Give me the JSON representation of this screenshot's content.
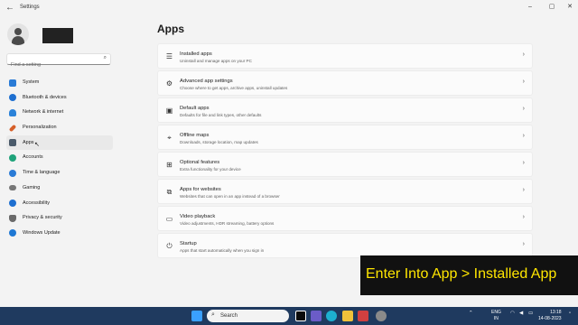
{
  "window": {
    "title": "Settings",
    "back_icon": "arrow-left-icon",
    "controls": [
      "minimize-icon",
      "maximize-icon",
      "close-icon"
    ]
  },
  "search": {
    "placeholder": "Find a setting"
  },
  "sidebar": {
    "items": [
      {
        "label": "System",
        "icon": "monitor-icon",
        "color": "#2a7bd6"
      },
      {
        "label": "Bluetooth & devices",
        "icon": "bluetooth-icon",
        "color": "#1e6fd0"
      },
      {
        "label": "Network & internet",
        "icon": "wifi-icon",
        "color": "#2b82d9"
      },
      {
        "label": "Personalization",
        "icon": "brush-icon",
        "color": "#d6602a"
      },
      {
        "label": "Apps",
        "icon": "apps-icon",
        "color": "#4a5a6a",
        "active": true
      },
      {
        "label": "Accounts",
        "icon": "person-icon",
        "color": "#1fa37a"
      },
      {
        "label": "Time & language",
        "icon": "globe-clock-icon",
        "color": "#2a7bd6"
      },
      {
        "label": "Gaming",
        "icon": "controller-icon",
        "color": "#777777"
      },
      {
        "label": "Accessibility",
        "icon": "accessibility-icon",
        "color": "#1e6fd0"
      },
      {
        "label": "Privacy & security",
        "icon": "shield-icon",
        "color": "#6a6a6a"
      },
      {
        "label": "Windows Update",
        "icon": "update-icon",
        "color": "#1e78d4"
      }
    ]
  },
  "main": {
    "title": "Apps",
    "cards": [
      {
        "title": "Installed apps",
        "subtitle": "Uninstall and manage apps on your PC",
        "icon": "list-icon"
      },
      {
        "title": "Advanced app settings",
        "subtitle": "Choose where to get apps, archive apps, uninstall updates",
        "icon": "app-settings-icon"
      },
      {
        "title": "Default apps",
        "subtitle": "Defaults for file and link types, other defaults",
        "icon": "default-apps-icon"
      },
      {
        "title": "Offline maps",
        "subtitle": "Downloads, storage location, map updates",
        "icon": "map-icon"
      },
      {
        "title": "Optional features",
        "subtitle": "Extra functionality for your device",
        "icon": "grid-plus-icon"
      },
      {
        "title": "Apps for websites",
        "subtitle": "Websites that can open in an app instead of a browser",
        "icon": "web-app-icon"
      },
      {
        "title": "Video playback",
        "subtitle": "Video adjustments, HDR streaming, battery options",
        "icon": "video-icon"
      },
      {
        "title": "Startup",
        "subtitle": "Apps that start automatically when you sign in",
        "icon": "startup-icon"
      }
    ]
  },
  "overlay": {
    "text": "Enter Into App > Installed App"
  },
  "taskbar": {
    "search_label": "Search",
    "lang_line1": "ENG",
    "lang_line2": "IN",
    "time": "13:18",
    "date": "14-08-2023"
  }
}
